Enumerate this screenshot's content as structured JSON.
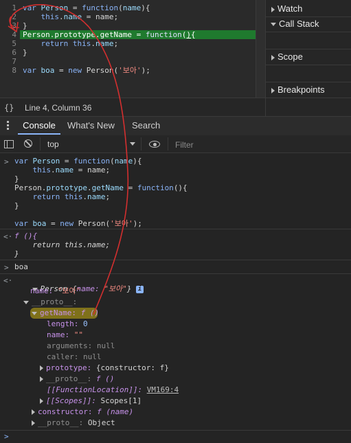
{
  "source": {
    "line_numbers": [
      "1",
      "2",
      "3",
      "4",
      "5",
      "6",
      "7",
      "8"
    ],
    "lines": [
      {
        "t": "var Person = function(name){"
      },
      {
        "t": "    this.name = name;"
      },
      {
        "t": "}"
      },
      {
        "t": "Person.prototype.getName = function(){"
      },
      {
        "t": "    return this.name;"
      },
      {
        "t": "}"
      },
      {
        "t": ""
      },
      {
        "t": "var boa = new Person('보아');"
      }
    ],
    "status": "Line 4, Column 36",
    "status_icon": "{}"
  },
  "sidebar": {
    "items": [
      "Watch",
      "Call Stack",
      "Scope",
      "Breakpoints"
    ]
  },
  "tabs": {
    "console": "Console",
    "whats_new": "What's New",
    "search": "Search"
  },
  "toolbar": {
    "context": "top",
    "filter_placeholder": "Filter"
  },
  "console": {
    "input1": [
      "var Person = function(name){",
      "    this.name = name;",
      "}",
      "Person.prototype.getName = function(){",
      "    return this.name;",
      "}",
      "",
      "var boa = new Person('보아');"
    ],
    "output1": [
      "f (){",
      "    return this.name;",
      "}"
    ],
    "input2": "boa",
    "obj_header_prefix": "Person {",
    "obj_header_name": "name: ",
    "obj_header_value": "\"보아\"",
    "obj_header_suffix": "}",
    "name_key": "name:",
    "name_val": "\"보아\"",
    "proto_key": "__proto__:",
    "getname_key": "getName:",
    "getname_val": "f ()",
    "length_key": "length:",
    "length_val": "0",
    "name2_key": "name:",
    "name2_val": "\"\"",
    "arguments_key": "arguments:",
    "arguments_val": "null",
    "caller_key": "caller:",
    "caller_val": "null",
    "prototype_key": "prototype:",
    "prototype_val": "{constructor: f}",
    "proto2_key": "__proto__:",
    "proto2_val": "f ()",
    "funcloc_key": "[[FunctionLocation]]:",
    "funcloc_val": "VM169:4",
    "scopes_key": "[[Scopes]]:",
    "scopes_val": "Scopes[1]",
    "constructor_key": "constructor:",
    "constructor_val": "f (name)",
    "proto3_key": "__proto__:",
    "proto3_val": "Object",
    "prompt": ">"
  },
  "colors": {
    "highlight_line": "#1f7a2e",
    "annotation": "#d32f2f",
    "marker": "#8a7a1a"
  }
}
